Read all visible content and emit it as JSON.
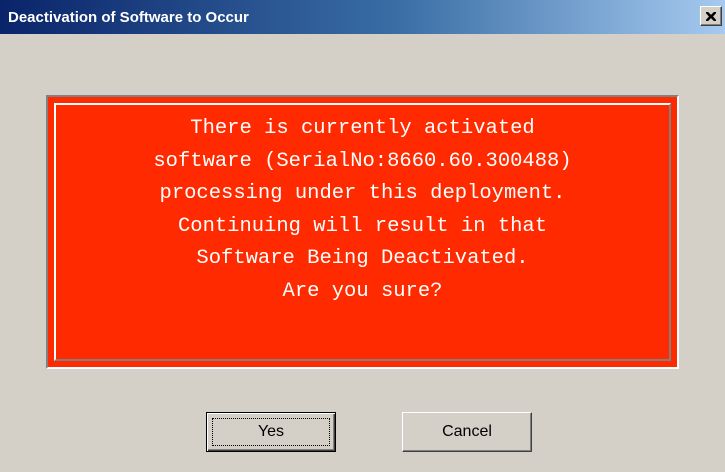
{
  "window": {
    "title": "Deactivation of Software to Occur",
    "close_icon": "close-x-icon"
  },
  "message": {
    "lines": [
      "There is currently activated",
      "software (SerialNo:8660.60.300488)",
      "processing under this deployment.",
      "Continuing will result in that",
      "Software Being Deactivated.",
      "Are you sure?"
    ],
    "background_color": "#ff2a00",
    "text_color": "#ffffff"
  },
  "buttons": {
    "yes_label": "Yes",
    "cancel_label": "Cancel"
  }
}
